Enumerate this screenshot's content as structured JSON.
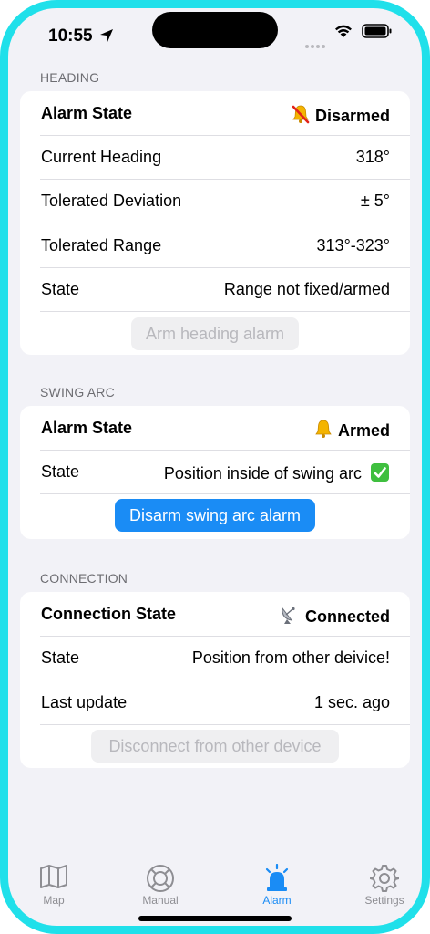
{
  "status_bar": {
    "time": "10:55"
  },
  "heading": {
    "header": "HEADING",
    "rows": [
      {
        "label": "Alarm State",
        "value": "Disarmed"
      },
      {
        "label": "Current Heading",
        "value": "318°"
      },
      {
        "label": "Tolerated Deviation",
        "value": "± 5°"
      },
      {
        "label": "Tolerated Range",
        "value": "313°-323°"
      },
      {
        "label": "State",
        "value": "Range not fixed/armed"
      }
    ],
    "button": "Arm heading alarm"
  },
  "swing_arc": {
    "header": "SWING ARC",
    "rows": [
      {
        "label": "Alarm State",
        "value": "Armed"
      },
      {
        "label": "State",
        "value": "Position inside of swing arc"
      }
    ],
    "button": "Disarm swing arc alarm"
  },
  "connection": {
    "header": "CONNECTION",
    "rows": [
      {
        "label": "Connection State",
        "value": "Connected"
      },
      {
        "label": "State",
        "value": "Position from other deivice!"
      },
      {
        "label": "Last update",
        "value": "1 sec. ago"
      }
    ],
    "button": "Disconnect from other device"
  },
  "icons": {
    "disarmed": "bell-slash-icon",
    "armed": "bell-icon",
    "check": "check-mark-icon",
    "connected": "satellite-antenna-icon"
  },
  "tabbar": {
    "tabs": [
      {
        "label": "Map",
        "icon": "map-icon"
      },
      {
        "label": "Manual",
        "icon": "lifebuoy-icon"
      },
      {
        "label": "Alarm",
        "icon": "siren-icon"
      },
      {
        "label": "Settings",
        "icon": "gear-icon"
      }
    ],
    "active": "Alarm"
  },
  "colors": {
    "accent": "#1a8cf5",
    "frame": "#20e0ea",
    "background": "#f2f2f7"
  }
}
